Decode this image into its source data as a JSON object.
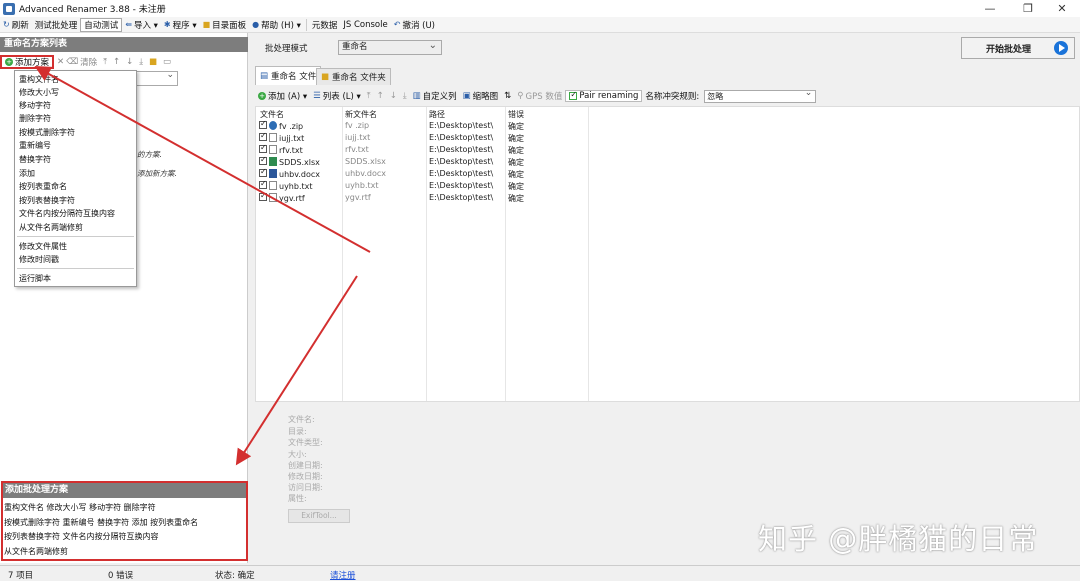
{
  "window": {
    "title": "Advanced Renamer 3.88 - 未注册",
    "minimize": "—",
    "maximize": "❐",
    "close": "✕"
  },
  "menubar": [
    {
      "icon": "refresh-icon",
      "label": "刷新"
    },
    {
      "label": "测试批处理"
    },
    {
      "label": "自动测试"
    },
    {
      "icon": "import-icon",
      "label": "导入 ▾"
    },
    {
      "icon": "program-icon",
      "label": "程序 ▾"
    },
    {
      "icon": "folder-icon",
      "label": "目录面板"
    },
    {
      "icon": "help-icon",
      "label": "帮助 (H) ▾"
    },
    {
      "label": "元数据"
    },
    {
      "label": "JS Console"
    },
    {
      "icon": "undo-icon",
      "label": "撤消 (U)"
    }
  ],
  "left_panel": {
    "header": "重命名方案列表",
    "toolbar": {
      "add": "添加方案",
      "delete": "清除"
    },
    "hint1": "的方案.",
    "hint2": "添加新方案."
  },
  "dropdown": {
    "items": [
      "重构文件名",
      "修改大小写",
      "移动字符",
      "删除字符",
      "按模式删除字符",
      "重新编号",
      "替换字符",
      "添加",
      "按列表重命名",
      "按列表替换字符",
      "文件名内按分隔符互换内容",
      "从文件名两端修剪"
    ],
    "items2": [
      "修改文件属性",
      "修改时间戳"
    ],
    "items3": [
      "运行脚本"
    ]
  },
  "right": {
    "mode_label": "批处理模式",
    "mode_value": "重命名",
    "start_button": "开始批处理",
    "tabs": [
      "重命名 文件",
      "重命名 文件夹"
    ],
    "file_toolbar": {
      "add": "添加 (A) ▾",
      "list": "列表 (L) ▾",
      "custom_columns": "自定义列",
      "thumbnails": "缩略图",
      "gps": "GPS 数值",
      "pair": "Pair renaming",
      "conflict_label": "名称冲突规则:",
      "conflict_value": "忽略"
    },
    "columns": [
      "文件名",
      "新文件名",
      "路径",
      "错误"
    ],
    "rows": [
      {
        "type": "zip",
        "name": "fv .zip",
        "new": "fv .zip",
        "path": "E:\\Desktop\\test\\",
        "err": "确定"
      },
      {
        "type": "txt",
        "name": "iujj.txt",
        "new": "iujj.txt",
        "path": "E:\\Desktop\\test\\",
        "err": "确定"
      },
      {
        "type": "txt",
        "name": "rfv.txt",
        "new": "rfv.txt",
        "path": "E:\\Desktop\\test\\",
        "err": "确定"
      },
      {
        "type": "xlsx",
        "name": "SDDS.xlsx",
        "new": "SDDS.xlsx",
        "path": "E:\\Desktop\\test\\",
        "err": "确定"
      },
      {
        "type": "docx",
        "name": "uhbv.docx",
        "new": "uhbv.docx",
        "path": "E:\\Desktop\\test\\",
        "err": "确定"
      },
      {
        "type": "txt",
        "name": "uyhb.txt",
        "new": "uyhb.txt",
        "path": "E:\\Desktop\\test\\",
        "err": "确定"
      },
      {
        "type": "rtf",
        "name": "ygv.rtf",
        "new": "ygv.rtf",
        "path": "E:\\Desktop\\test\\",
        "err": "确定"
      }
    ],
    "info_labels": [
      "文件名:",
      "目录:",
      "文件类型:",
      "大小:",
      "创建日期:",
      "修改日期:",
      "访问日期:",
      "属性:"
    ],
    "exif_button": "ExifTool..."
  },
  "bottom_panel": {
    "header": "添加批处理方案",
    "lines": [
      "重构文件名   修改大小写   移动字符   删除字符",
      "按模式删除字符   重新编号   替换字符   添加   按列表重命名",
      "按列表替换字符   文件名内按分隔符互换内容",
      "从文件名两端修剪"
    ]
  },
  "status": {
    "items": "7 项目",
    "errors": "0 错误",
    "state": "状态: 确定",
    "register": "请注册"
  },
  "watermark": "知乎 @胖橘猫的日常",
  "colors": {
    "highlight": "#d32f2f",
    "header_gray": "#7d7d7d",
    "accent_blue": "#1a73d9"
  }
}
